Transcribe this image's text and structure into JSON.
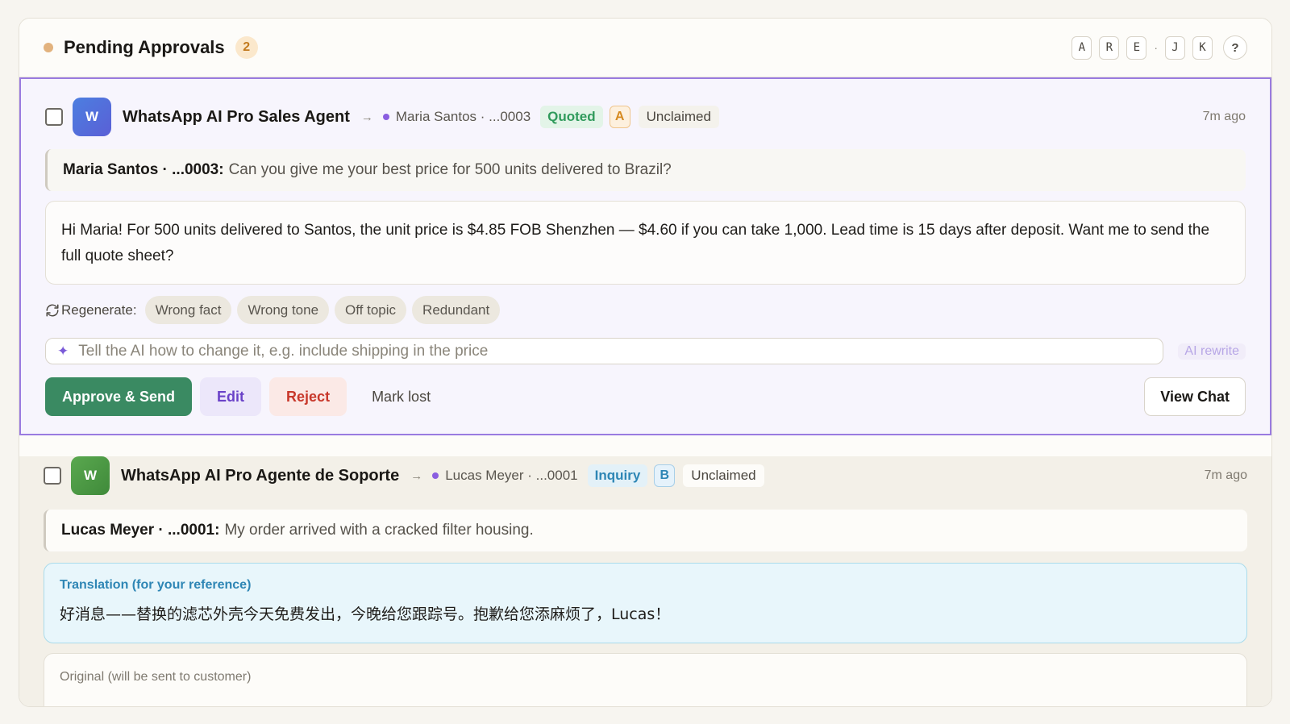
{
  "header": {
    "title": "Pending Approvals",
    "count": "2",
    "hotkeys": [
      "A",
      "R",
      "E",
      "J",
      "K"
    ],
    "hotkey_separator": "·",
    "help_label": "?"
  },
  "cards": [
    {
      "avatar_letter": "W",
      "agent_name": "WhatsApp AI Pro Sales Agent",
      "contact": "Maria Santos · ...0003",
      "stage": "Quoted",
      "tier": "A",
      "claim": "Unclaimed",
      "time": "7m ago",
      "sender": "Maria Santos · ...0003:",
      "message": "Can you give me your best price for 500 units delivered to Brazil?",
      "draft": "Hi Maria! For 500 units delivered to Santos, the unit price is $4.85 FOB Shenzhen — $4.60 if you can take 1,000. Lead time is 15 days after deposit. Want me to send the full quote sheet?",
      "regenerate_label": "Regenerate:",
      "regenerate_options": [
        "Wrong fact",
        "Wrong tone",
        "Off topic",
        "Redundant"
      ],
      "rewrite_placeholder": "Tell the AI how to change it, e.g. include shipping in the price",
      "rewrite_button": "AI rewrite",
      "actions": {
        "approve": "Approve & Send",
        "edit": "Edit",
        "reject": "Reject",
        "mark_lost": "Mark lost",
        "view_chat": "View Chat"
      }
    },
    {
      "avatar_letter": "W",
      "agent_name": "WhatsApp AI Pro Agente de Soporte",
      "contact": "Lucas Meyer · ...0001",
      "stage": "Inquiry",
      "tier": "B",
      "claim": "Unclaimed",
      "time": "7m ago",
      "sender": "Lucas Meyer · ...0001:",
      "message": "My order arrived with a cracked filter housing.",
      "translation_label": "Translation (for your reference)",
      "translation_text": "好消息——替换的滤芯外壳今天免费发出，今晚给您跟踪号。抱歉给您添麻烦了，Lucas！",
      "original_label": "Original (will be sent to customer)"
    }
  ],
  "colors": {
    "accent_purple": "#9a7be0",
    "approve_green": "#3a8a62",
    "reject_red": "#c8382b",
    "pending_orange": "#e2b27e"
  }
}
